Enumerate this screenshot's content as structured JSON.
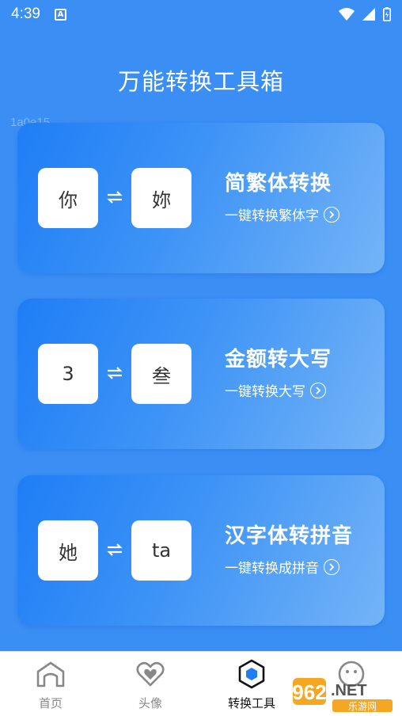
{
  "status": {
    "time": "4:39",
    "badge": "A"
  },
  "header": {
    "title": "万能转换工具箱"
  },
  "watermark": "1a0e15",
  "cards": [
    {
      "left": "你",
      "right": "妳",
      "title": "简繁体转换",
      "subtitle": "一键转换繁体字"
    },
    {
      "left": "3",
      "right": "叁",
      "title": "金额转大写",
      "subtitle": "一键转换大写"
    },
    {
      "left": "她",
      "right": "ta",
      "title": "汉字体转拼音",
      "subtitle": "一键转换成拼音"
    }
  ],
  "tabs": [
    {
      "label": "首页",
      "icon": "home-icon"
    },
    {
      "label": "头像",
      "icon": "heart-icon"
    },
    {
      "label": "转换工具",
      "icon": "hexagon-icon",
      "active": true
    },
    {
      "label": "",
      "icon": "smiley-icon"
    }
  ],
  "logo": {
    "text": "962.NET",
    "sub": "乐游网"
  },
  "colors": {
    "background": "#3a8ef4",
    "card_start": "#1f7ef6",
    "card_end": "#74b4f7"
  }
}
